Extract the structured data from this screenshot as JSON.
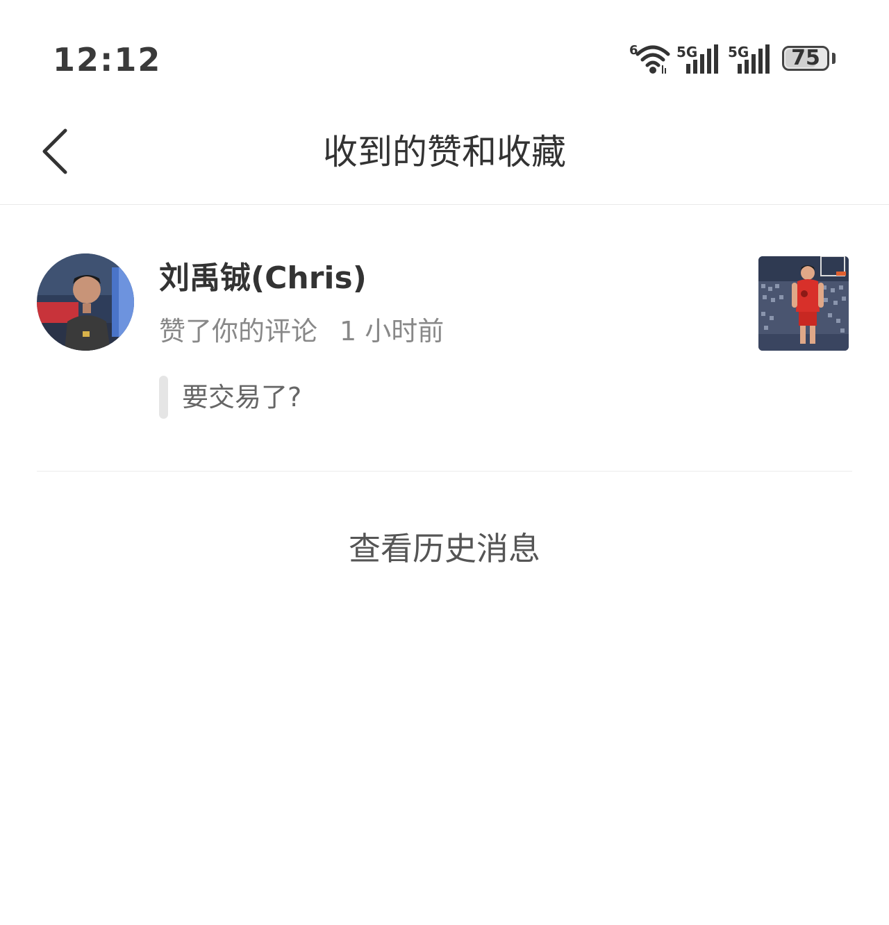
{
  "status_bar": {
    "time": "12:12",
    "wifi_badge": "6",
    "sim1_label": "5G",
    "sim2_label": "5G",
    "battery_level": "75",
    "icons": [
      "wifi-icon",
      "signal-icon",
      "signal-icon",
      "battery-icon"
    ]
  },
  "nav": {
    "title": "收到的赞和收藏",
    "back_icon": "chevron-left-icon"
  },
  "notifications": [
    {
      "user_name": "刘禹铖(Chris)",
      "action": "赞了你的评论",
      "time_ago": "1 小时前",
      "quoted_comment": "要交易了?"
    }
  ],
  "footer": {
    "history_label": "查看历史消息"
  },
  "colors": {
    "background": "#ffffff",
    "title_text": "#333333",
    "secondary_text": "#888888",
    "quote_bar": "#e5e5e5",
    "divider": "#ececec"
  }
}
